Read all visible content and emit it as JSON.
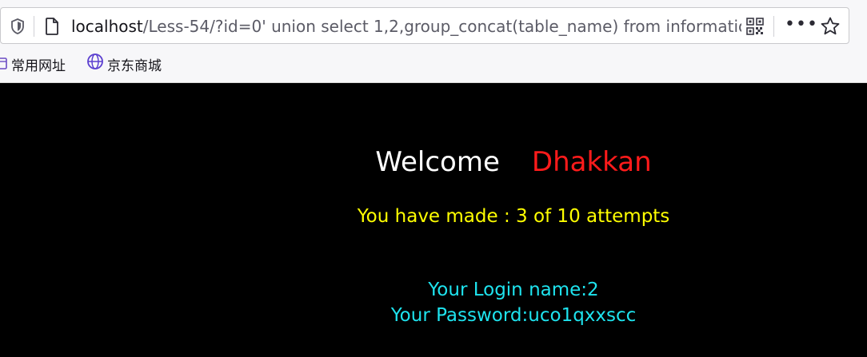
{
  "browser": {
    "url_host": "localhost",
    "url_path": "/Less-54/?id=0' union select 1,2,group_concat(table_name) from informatio",
    "more_label": "•••",
    "icons": {
      "tracking": "shield-icon",
      "page": "page-icon",
      "qr": "qr-code-icon",
      "more": "more-icon",
      "bookmark": "star-icon"
    }
  },
  "bookmarks": [
    {
      "label": "常用网址",
      "icon": "folder-icon"
    },
    {
      "label": "京东商城",
      "icon": "globe-icon"
    }
  ],
  "page": {
    "welcome": "Welcome",
    "user": "Dhakkan",
    "attempts": "You have made : 3 of 10 attempts",
    "login_name": "Your Login name:2",
    "password": "Your Password:uco1qxxscc"
  },
  "colors": {
    "background": "#000000",
    "welcome": "#ffffff",
    "user": "#ff1b1b",
    "attempts": "#ffff00",
    "result": "#1ee3ee"
  }
}
